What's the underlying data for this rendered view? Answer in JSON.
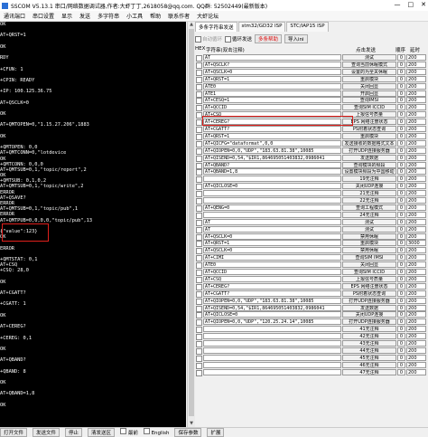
{
  "window": {
    "title": "SSCOM V5.13.1 串口/网络数据调试器,作者:大虾丁丁,2618058@qq.com. QQ群: 52502449(最新版本)",
    "controls": [
      "—",
      "□",
      "✕"
    ]
  },
  "menu": [
    "通讯端口",
    "串口设置",
    "显示",
    "发送",
    "多字符串",
    "小工具",
    "帮助",
    "联系作者",
    "大虾论坛"
  ],
  "terminal": {
    "lines": [
      "OK",
      "",
      "AT+QRST=1",
      "",
      "OK",
      "",
      "RDY",
      "",
      "+CFUN: 1",
      "",
      "+CPIN: READY",
      "",
      "+IP: 100.125.36.75",
      "",
      "AT+QSCLK=0",
      "",
      "OK",
      "",
      "AT+QMTOPEN=0,\"1.15.27.206\",1883",
      "",
      "OK",
      "",
      "+QMTOPEN: 0,0",
      "AT+QMTCONN=0,\"lotdevice",
      "OK",
      "+QMTCONN: 0,0,0",
      "AT+QMTSUB=0,1,\"topic/report\",2",
      "OK",
      "+QMTSUB: 0,1,0,2",
      "AT+QMTSUB=0,1,\"topic/write\",2",
      "ERROR",
      "AT+QSAVE?",
      "ERROR",
      "AT+QMTSUB=0,1,\"topic/pub\",1",
      "ERROR",
      "AT+QMTPUB=0,0,0,0,\"topic/pub\",13",
      "",
      "{\"value\":123}",
      "OK",
      "",
      "ERROR",
      "",
      "+QMTSTAT: 0,1",
      "AT+CSQ",
      "+CSQ: 28,0",
      "",
      "OK",
      "",
      "AT+CGATT?",
      "",
      "+CGATT: 1",
      "",
      "OK",
      "",
      "AT+CEREG?",
      "",
      "+CEREG: 0,1",
      "",
      "OK",
      "",
      "AT+QBAND?",
      "",
      "+QBAND: 8",
      "",
      "OK",
      "",
      "AT+QBAND=1,8",
      "",
      "OK",
      ""
    ]
  },
  "right": {
    "tabs": [
      "多条字符串发送",
      "stm32/GD32 ISP",
      "STC/IAP15 ISP"
    ],
    "toolbar": {
      "auto_loop": "自动循环",
      "loop_send": "循环发送",
      "multi_help": "多条帮助",
      "import_ini": "导入ini"
    },
    "headers": {
      "hex": "HEX",
      "string": "字符串(双击注释)",
      "click_send": "点击发送",
      "order": "顺序",
      "delay": "延时"
    },
    "rows": [
      {
        "cmd": "AT",
        "btn": "测试",
        "seq": "0",
        "delay": "200"
      },
      {
        "cmd": "AT+QSCLK?",
        "btn": "查询当前休眠模式",
        "seq": "0",
        "delay": "200"
      },
      {
        "cmd": "AT+QSCLK=0",
        "btn": "设置的为全关休眠",
        "seq": "0",
        "delay": "200"
      },
      {
        "cmd": "AT+QRST=1",
        "btn": "重启模块",
        "seq": "0",
        "delay": "200"
      },
      {
        "cmd": "ATE0",
        "btn": "关闭回显",
        "seq": "0",
        "delay": "200"
      },
      {
        "cmd": "ATE1",
        "btn": "开启回显",
        "seq": "0",
        "delay": "200"
      },
      {
        "cmd": "AT+CESQ=1",
        "btn": "查询IMSI",
        "seq": "0",
        "delay": "200"
      },
      {
        "cmd": "AT+QCCID",
        "btn": "查询SIM ICCID",
        "seq": "0",
        "delay": "200"
      },
      {
        "cmd": "AT+CSQ",
        "btn": "上报信号质量",
        "seq": "0",
        "delay": "200"
      },
      {
        "cmd": "AT+CEREG?",
        "btn": "EPS 网络注册状态",
        "seq": "0",
        "delay": "200"
      },
      {
        "cmd": "AT+CGATT?",
        "btn": "PS附着状态查询",
        "seq": "0",
        "delay": "200"
      },
      {
        "cmd": "AT+QRST=1",
        "btn": "重启模块",
        "seq": "0",
        "delay": "200"
      },
      {
        "cmd": "AT+QICFG=\"dataformat\",0,0",
        "btn": "发送接收的数据格式文本",
        "seq": "0",
        "delay": "200"
      },
      {
        "cmd": "AT+QIOPEN=0,0,\"UDP\",\"183.63.81.38\",10085",
        "btn": "打开UDP连接服务器",
        "seq": "0",
        "delay": "200"
      },
      {
        "cmd": "AT+QISEND=0,54,\"$IR1,864695051403832,0986041",
        "btn": "发送数据",
        "seq": "0",
        "delay": "200"
      },
      {
        "cmd": "AT+QBAND?",
        "btn": "查询模块的频段",
        "seq": "0",
        "delay": "200"
      },
      {
        "cmd": "AT+QBAND=1,8",
        "btn": "设置模块频段为中国移动",
        "seq": "0",
        "delay": "200"
      },
      {
        "cmd": "",
        "btn": "19无注释",
        "seq": "0",
        "delay": "200"
      },
      {
        "cmd": "AT+QICLOSE=0",
        "btn": "关闭UDP连接",
        "seq": "0",
        "delay": "200"
      },
      {
        "cmd": "",
        "btn": "21无注释",
        "seq": "0",
        "delay": "200"
      },
      {
        "cmd": "",
        "btn": "22无注释",
        "seq": "0",
        "delay": "200"
      },
      {
        "cmd": "AT+QENG=0",
        "btn": "查询工程模式",
        "seq": "0",
        "delay": "200"
      },
      {
        "cmd": "",
        "btn": "24无注释",
        "seq": "0",
        "delay": "200"
      },
      {
        "cmd": "AT",
        "btn": "测试",
        "seq": "0",
        "delay": "200"
      },
      {
        "cmd": "AT",
        "btn": "测试",
        "seq": "0",
        "delay": "200"
      },
      {
        "cmd": "AT+QSCLK=0",
        "btn": "禁用休眠",
        "seq": "0",
        "delay": "200"
      },
      {
        "cmd": "AT+QRST=1",
        "btn": "重启模块",
        "seq": "0",
        "delay": "3000"
      },
      {
        "cmd": "AT+QSCLK=0",
        "btn": "禁用休眠",
        "seq": "0",
        "delay": "200"
      },
      {
        "cmd": "AT+CIMI",
        "btn": "查询SIM IMSI",
        "seq": "0",
        "delay": "200"
      },
      {
        "cmd": "ATE0",
        "btn": "关闭回显",
        "seq": "0",
        "delay": "200"
      },
      {
        "cmd": "AT+QCCID",
        "btn": "查询SIM ICCID",
        "seq": "0",
        "delay": "200"
      },
      {
        "cmd": "AT+CSQ",
        "btn": "上报信号质量",
        "seq": "0",
        "delay": "200"
      },
      {
        "cmd": "AT+CEREG?",
        "btn": "EPS 网络注册状态",
        "seq": "0",
        "delay": "200"
      },
      {
        "cmd": "AT+CGATT?",
        "btn": "PS附着状态查询",
        "seq": "0",
        "delay": "200"
      },
      {
        "cmd": "AT+QIOPEN=0,0,\"UDP\",\"183.63.81.38\",10085",
        "btn": "打开UDP连接服务器",
        "seq": "0",
        "delay": "200"
      },
      {
        "cmd": "AT+QISEND=0,54,\"$IR1,864695051403832,0986041",
        "btn": "发送数据",
        "seq": "0",
        "delay": "200"
      },
      {
        "cmd": "AT+QICLOSE=0",
        "btn": "关闭UDP连接",
        "seq": "0",
        "delay": "200"
      },
      {
        "cmd": "AT+QIOPEN=0,0,\"UDP\",\"120.25.24.14\",10085",
        "btn": "打开UDP连接服务器",
        "seq": "0",
        "delay": "200"
      },
      {
        "cmd": "",
        "btn": "41无注释",
        "seq": "0",
        "delay": "200"
      },
      {
        "cmd": "",
        "btn": "42无注释",
        "seq": "0",
        "delay": "200"
      },
      {
        "cmd": "",
        "btn": "43无注释",
        "seq": "0",
        "delay": "200"
      },
      {
        "cmd": "",
        "btn": "44无注释",
        "seq": "0",
        "delay": "200"
      },
      {
        "cmd": "",
        "btn": "45无注释",
        "seq": "0",
        "delay": "200"
      },
      {
        "cmd": "",
        "btn": "46无注释",
        "seq": "0",
        "delay": "200"
      },
      {
        "cmd": "",
        "btn": "47无注释",
        "seq": "0",
        "delay": "200"
      }
    ]
  },
  "status": {
    "open_file": "打开文件",
    "send_file": "发送文件",
    "stop": "停止",
    "clear": "清发送区",
    "front": "最前",
    "english": "English",
    "save_params": "保存参数",
    "expand": "扩展"
  },
  "colors": {
    "highlight_box": "#e0201c",
    "terminal_bg": "#000000",
    "terminal_text": "#ffffff"
  }
}
